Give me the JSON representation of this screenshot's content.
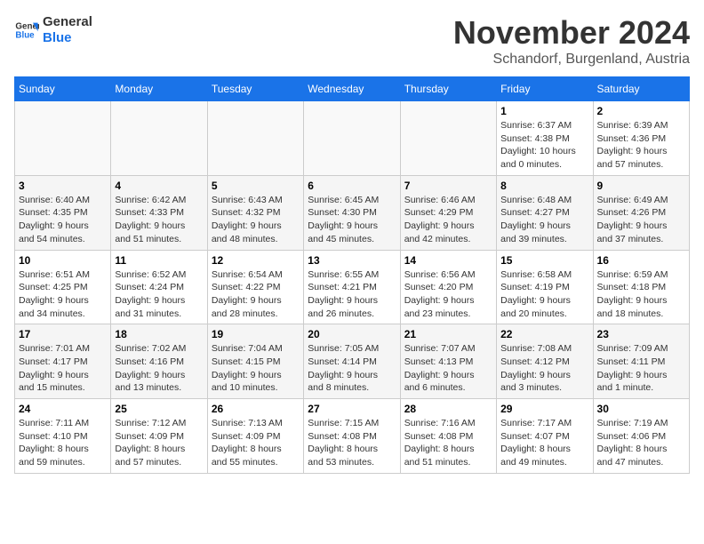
{
  "header": {
    "logo": {
      "line1": "General",
      "line2": "Blue"
    },
    "title": "November 2024",
    "subtitle": "Schandorf, Burgenland, Austria"
  },
  "calendar": {
    "weekdays": [
      "Sunday",
      "Monday",
      "Tuesday",
      "Wednesday",
      "Thursday",
      "Friday",
      "Saturday"
    ],
    "weeks": [
      [
        {
          "day": "",
          "info": ""
        },
        {
          "day": "",
          "info": ""
        },
        {
          "day": "",
          "info": ""
        },
        {
          "day": "",
          "info": ""
        },
        {
          "day": "",
          "info": ""
        },
        {
          "day": "1",
          "info": "Sunrise: 6:37 AM\nSunset: 4:38 PM\nDaylight: 10 hours\nand 0 minutes."
        },
        {
          "day": "2",
          "info": "Sunrise: 6:39 AM\nSunset: 4:36 PM\nDaylight: 9 hours\nand 57 minutes."
        }
      ],
      [
        {
          "day": "3",
          "info": "Sunrise: 6:40 AM\nSunset: 4:35 PM\nDaylight: 9 hours\nand 54 minutes."
        },
        {
          "day": "4",
          "info": "Sunrise: 6:42 AM\nSunset: 4:33 PM\nDaylight: 9 hours\nand 51 minutes."
        },
        {
          "day": "5",
          "info": "Sunrise: 6:43 AM\nSunset: 4:32 PM\nDaylight: 9 hours\nand 48 minutes."
        },
        {
          "day": "6",
          "info": "Sunrise: 6:45 AM\nSunset: 4:30 PM\nDaylight: 9 hours\nand 45 minutes."
        },
        {
          "day": "7",
          "info": "Sunrise: 6:46 AM\nSunset: 4:29 PM\nDaylight: 9 hours\nand 42 minutes."
        },
        {
          "day": "8",
          "info": "Sunrise: 6:48 AM\nSunset: 4:27 PM\nDaylight: 9 hours\nand 39 minutes."
        },
        {
          "day": "9",
          "info": "Sunrise: 6:49 AM\nSunset: 4:26 PM\nDaylight: 9 hours\nand 37 minutes."
        }
      ],
      [
        {
          "day": "10",
          "info": "Sunrise: 6:51 AM\nSunset: 4:25 PM\nDaylight: 9 hours\nand 34 minutes."
        },
        {
          "day": "11",
          "info": "Sunrise: 6:52 AM\nSunset: 4:24 PM\nDaylight: 9 hours\nand 31 minutes."
        },
        {
          "day": "12",
          "info": "Sunrise: 6:54 AM\nSunset: 4:22 PM\nDaylight: 9 hours\nand 28 minutes."
        },
        {
          "day": "13",
          "info": "Sunrise: 6:55 AM\nSunset: 4:21 PM\nDaylight: 9 hours\nand 26 minutes."
        },
        {
          "day": "14",
          "info": "Sunrise: 6:56 AM\nSunset: 4:20 PM\nDaylight: 9 hours\nand 23 minutes."
        },
        {
          "day": "15",
          "info": "Sunrise: 6:58 AM\nSunset: 4:19 PM\nDaylight: 9 hours\nand 20 minutes."
        },
        {
          "day": "16",
          "info": "Sunrise: 6:59 AM\nSunset: 4:18 PM\nDaylight: 9 hours\nand 18 minutes."
        }
      ],
      [
        {
          "day": "17",
          "info": "Sunrise: 7:01 AM\nSunset: 4:17 PM\nDaylight: 9 hours\nand 15 minutes."
        },
        {
          "day": "18",
          "info": "Sunrise: 7:02 AM\nSunset: 4:16 PM\nDaylight: 9 hours\nand 13 minutes."
        },
        {
          "day": "19",
          "info": "Sunrise: 7:04 AM\nSunset: 4:15 PM\nDaylight: 9 hours\nand 10 minutes."
        },
        {
          "day": "20",
          "info": "Sunrise: 7:05 AM\nSunset: 4:14 PM\nDaylight: 9 hours\nand 8 minutes."
        },
        {
          "day": "21",
          "info": "Sunrise: 7:07 AM\nSunset: 4:13 PM\nDaylight: 9 hours\nand 6 minutes."
        },
        {
          "day": "22",
          "info": "Sunrise: 7:08 AM\nSunset: 4:12 PM\nDaylight: 9 hours\nand 3 minutes."
        },
        {
          "day": "23",
          "info": "Sunrise: 7:09 AM\nSunset: 4:11 PM\nDaylight: 9 hours\nand 1 minute."
        }
      ],
      [
        {
          "day": "24",
          "info": "Sunrise: 7:11 AM\nSunset: 4:10 PM\nDaylight: 8 hours\nand 59 minutes."
        },
        {
          "day": "25",
          "info": "Sunrise: 7:12 AM\nSunset: 4:09 PM\nDaylight: 8 hours\nand 57 minutes."
        },
        {
          "day": "26",
          "info": "Sunrise: 7:13 AM\nSunset: 4:09 PM\nDaylight: 8 hours\nand 55 minutes."
        },
        {
          "day": "27",
          "info": "Sunrise: 7:15 AM\nSunset: 4:08 PM\nDaylight: 8 hours\nand 53 minutes."
        },
        {
          "day": "28",
          "info": "Sunrise: 7:16 AM\nSunset: 4:08 PM\nDaylight: 8 hours\nand 51 minutes."
        },
        {
          "day": "29",
          "info": "Sunrise: 7:17 AM\nSunset: 4:07 PM\nDaylight: 8 hours\nand 49 minutes."
        },
        {
          "day": "30",
          "info": "Sunrise: 7:19 AM\nSunset: 4:06 PM\nDaylight: 8 hours\nand 47 minutes."
        }
      ]
    ]
  }
}
